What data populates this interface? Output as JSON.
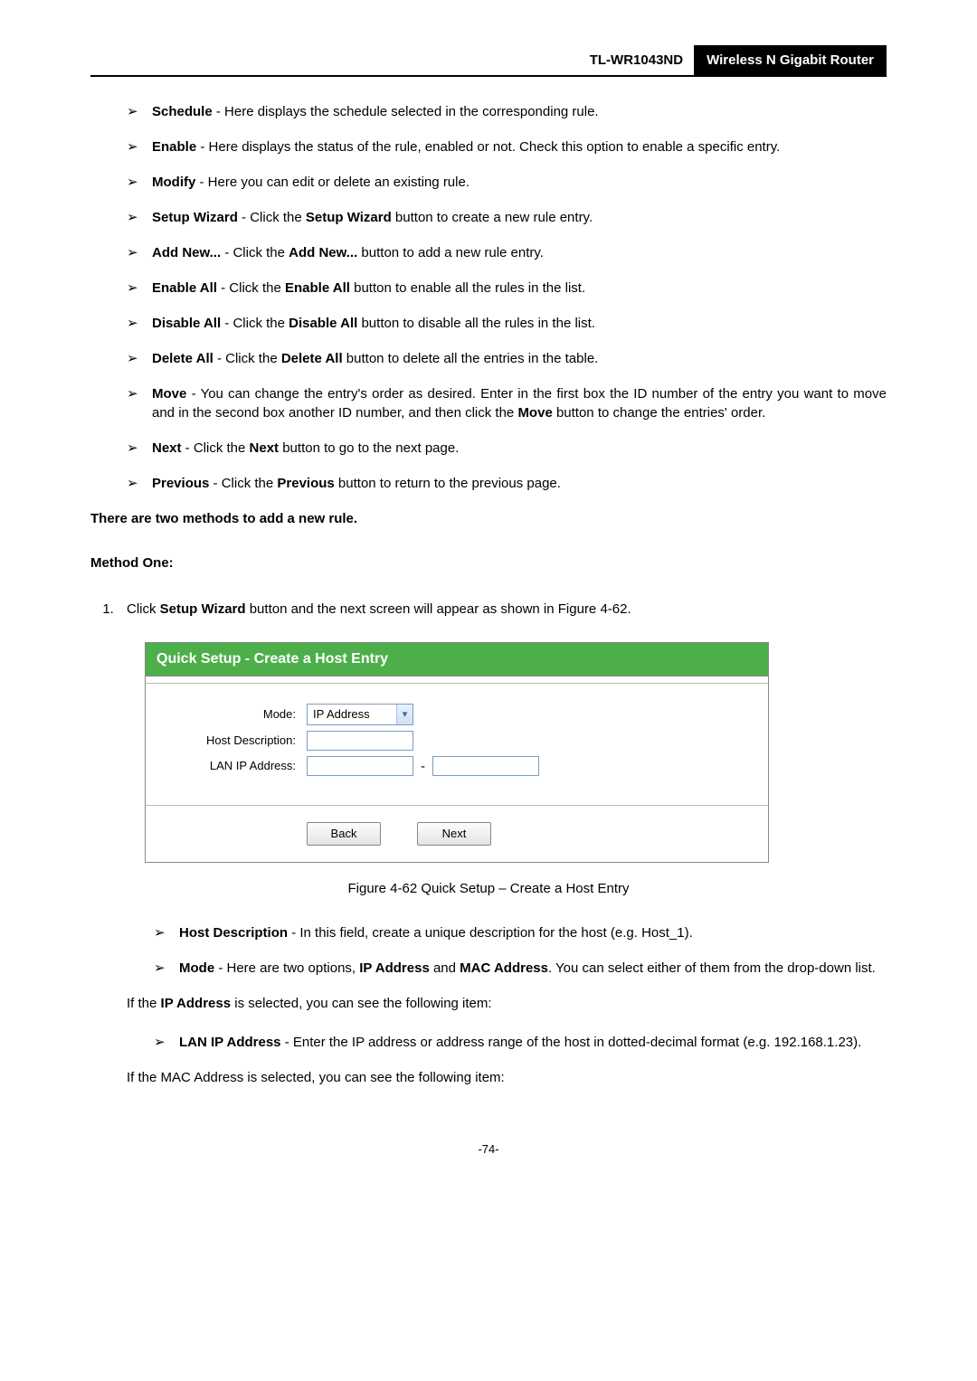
{
  "header": {
    "model": "TL-WR1043ND",
    "product": "Wireless N Gigabit Router"
  },
  "bullets1": [
    {
      "term": "Schedule",
      "desc": " - Here displays the schedule selected in the corresponding rule."
    },
    {
      "term": "Enable",
      "desc": " - Here displays the status of the rule, enabled or not. Check this option to enable a specific entry."
    },
    {
      "term": "Modify",
      "desc": " - Here you can edit or delete an existing rule."
    },
    {
      "term": "Setup Wizard",
      "desc_pre": " - Click the ",
      "desc_mid": "Setup Wizard",
      "desc_post": " button to create a new rule entry."
    },
    {
      "term": "Add New...  ",
      "desc_pre": " - Click the ",
      "desc_mid": "Add New...",
      "desc_post": " button to add a new rule entry."
    },
    {
      "term": "Enable All",
      "desc_pre": " - Click the ",
      "desc_mid": "Enable All",
      "desc_post": " button to enable all the rules in the list."
    },
    {
      "term": "Disable All",
      "desc_pre": " - Click the ",
      "desc_mid": "Disable All",
      "desc_post": " button to disable all the rules in the list."
    },
    {
      "term": "Delete All",
      "desc_pre": " - Click the ",
      "desc_mid": "Delete All",
      "desc_post": " button to delete all the entries in the table."
    },
    {
      "term": "Move",
      "desc_pre": " - You can change the entry's order as desired. Enter in the first box the ID number of the entry you want to move and in the second box another ID number, and then click the ",
      "desc_mid": "Move",
      "desc_post": " button to change the entries' order."
    },
    {
      "term": "Next",
      "desc_pre": " - Click the ",
      "desc_mid": "Next",
      "desc_post": " button to go to the next page."
    },
    {
      "term": "Previous",
      "desc_pre": " - Click the ",
      "desc_mid": "Previous",
      "desc_post": " button to return to the previous page."
    }
  ],
  "section_intro": "There are two methods to add a new rule.",
  "method_one": "Method One:",
  "step1_pre": "Click ",
  "step1_bold": "Setup Wizard",
  "step1_post": " button and the next screen will appear as shown in Figure 4-62.",
  "figure": {
    "title": "Quick Setup - Create a Host Entry",
    "labels": {
      "mode": "Mode:",
      "host_desc": "Host Description:",
      "lan_ip": "LAN IP Address:"
    },
    "mode_value": "IP Address",
    "ip_sep": "-",
    "btn_back": "Back",
    "btn_next": "Next",
    "caption": "Figure 4-62    Quick Setup – Create a Host Entry"
  },
  "bullets2": [
    {
      "term": "Host Description",
      "desc": " - In this field, create a unique description for the host (e.g. Host_1)."
    },
    {
      "term": "Mode",
      "desc_pre": " - Here are two options, ",
      "desc_mid": "IP Address",
      "desc_mid2": " and ",
      "desc_mid3": "MAC Address",
      "desc_post": ". You can select either of them from the drop-down list."
    }
  ],
  "para_ip_pre": "If the ",
  "para_ip_bold": "IP Address",
  "para_ip_post": " is selected, you can see the following item:",
  "bullets3": [
    {
      "term": "LAN IP Address",
      "desc": " - Enter the IP address or address range of the host in dotted-decimal format (e.g. 192.168.1.23)."
    }
  ],
  "para_mac": "If the MAC Address is selected, you can see the following item:",
  "page_number": "-74-"
}
